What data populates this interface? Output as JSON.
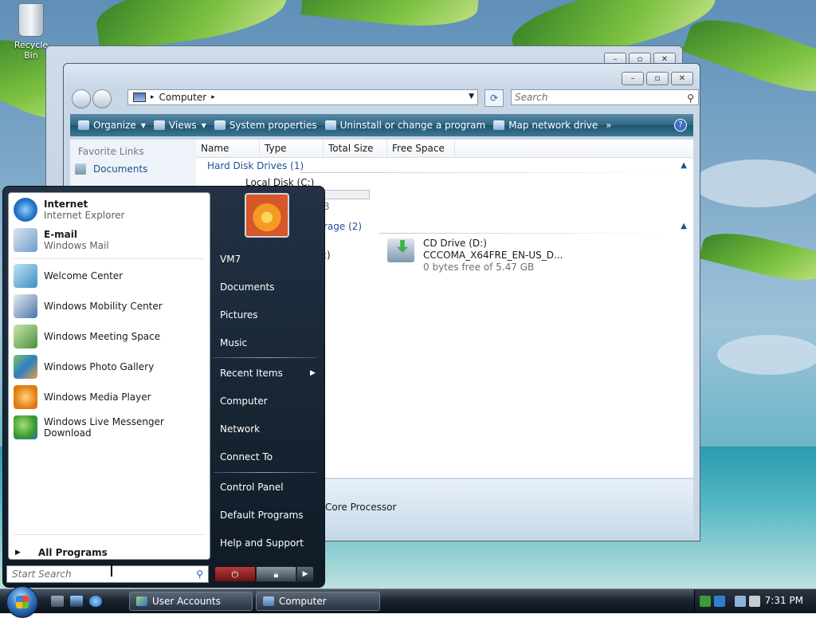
{
  "desktop": {
    "recycle_bin_label": "Recycle Bin"
  },
  "explorer": {
    "address": "Computer",
    "search_placeholder": "Search",
    "toolbar": {
      "organize": "Organize",
      "views": "Views",
      "system_properties": "System properties",
      "uninstall": "Uninstall or change a program",
      "map_drive": "Map network drive",
      "more": "»"
    },
    "nav": {
      "header": "Favorite Links",
      "documents": "Documents"
    },
    "columns": [
      "Name",
      "Type",
      "Total Size",
      "Free Space"
    ],
    "groups": {
      "hdd": "Hard Disk Drives (1)",
      "removable": "rage (2)"
    },
    "local_disk": {
      "name": "Local Disk (C:)",
      "size_suffix": "GB"
    },
    "floppy_partial": "A:)",
    "cd": {
      "name": "CD Drive (D:)",
      "label": "CCCOMA_X64FRE_EN-US_D...",
      "free": "0 bytes free of 5.47 GB"
    },
    "details_text": "Core Processor"
  },
  "start_menu": {
    "pinned": [
      {
        "title": "Internet",
        "subtitle": "Internet Explorer"
      },
      {
        "title": "E-mail",
        "subtitle": "Windows Mail"
      }
    ],
    "recent": [
      "Welcome Center",
      "Windows Mobility Center",
      "Windows Meeting Space",
      "Windows Photo Gallery",
      "Windows Media Player",
      "Windows Live Messenger Download"
    ],
    "all_programs": "All Programs",
    "search_placeholder": "Start Search",
    "right": {
      "user": "VM7",
      "documents": "Documents",
      "pictures": "Pictures",
      "music": "Music",
      "recent_items": "Recent Items",
      "computer": "Computer",
      "network": "Network",
      "connect_to": "Connect To",
      "control_panel": "Control Panel",
      "default_programs": "Default Programs",
      "help": "Help and Support"
    }
  },
  "taskbar": {
    "tasks": [
      "User Accounts",
      "Computer"
    ],
    "clock": "7:31 PM"
  },
  "colors": {
    "toolbar": "#2f6784",
    "link": "#1f4f9a",
    "start_bg": "#0f1a25"
  }
}
